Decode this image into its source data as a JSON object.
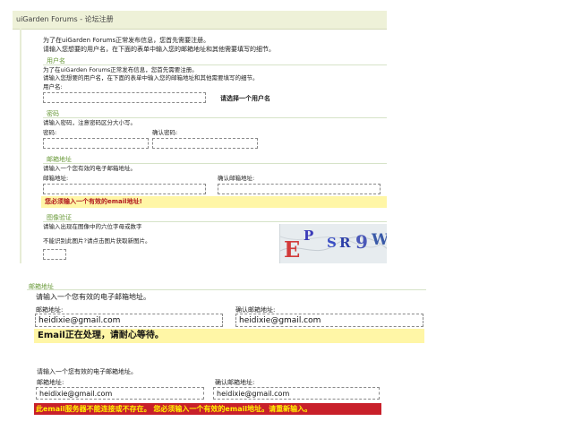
{
  "panel1": {
    "window_title": "uiGarden Forums - 论坛注册",
    "intro_line1": "为了在uiGarden Forums正常发布信息，您首先需要注册。",
    "intro_line2": "请输入您想要的用户名，在下面的表单中输入您的邮箱地址和其他需要填写的细节。",
    "username": {
      "section_title": "用户名",
      "intro_line1": "为了在uiGarden Forums正常发布信息，您首先需要注册。",
      "intro_line2": "请输入您想要的用户名，在下面的表单中输入您的邮箱地址和其他需要填写的细节。",
      "label": "用户名:",
      "value": "",
      "hint": "请选择一个用户名"
    },
    "password": {
      "section_title": "密码",
      "desc": "请输入密码，注意密码区分大小写。",
      "label": "密码:",
      "confirm_label": "确认密码:"
    },
    "email": {
      "section_title": "邮箱地址",
      "desc": "请输入一个您有效的电子邮箱地址。",
      "label": "邮箱地址:",
      "confirm_label": "确认邮箱地址:",
      "error": "您必须输入一个有效的email地址!"
    },
    "captcha": {
      "section_title": "图像验证",
      "desc": "请输入出现在图像中的六位字母或数字",
      "refresh_hint": "不能识别此图片?请点击图片获取新图片。",
      "chars": [
        "E",
        "P",
        "S",
        "R",
        "9",
        "W"
      ],
      "char_colors": [
        "#d23b3b",
        "#3b3bb8",
        "#3b4fc4",
        "#2c3fa8",
        "#4a58b8",
        "#3a5aa8"
      ]
    }
  },
  "panel2": {
    "section_title": "邮箱地址",
    "desc": "请输入一个您有效的电子邮箱地址。",
    "label": "邮箱地址:",
    "confirm_label": "确认邮箱地址:",
    "email_value": "heidixie@gmail.com",
    "confirm_value": "heidixie@gmail.com",
    "status": "Email正在处理，请耐心等待。",
    "status_bg": "#fff6a6"
  },
  "panel3": {
    "desc": "请输入一个您有效的电子邮箱地址。",
    "label": "邮箱地址:",
    "confirm_label": "确认邮箱地址:",
    "email_value": "heidixie@gmail.com",
    "confirm_value": "heidixie@gmail.com",
    "error": "此email服务器不能连接或不存在。  您必须输入一个有效的email地址。请重新输入。",
    "error_bg": "#c8202a"
  },
  "colors": {
    "accent_green": "#6a9a3a",
    "title_bar": "#eef1d8",
    "error_yellow": "#fff6a6",
    "error_red": "#c8202a"
  }
}
